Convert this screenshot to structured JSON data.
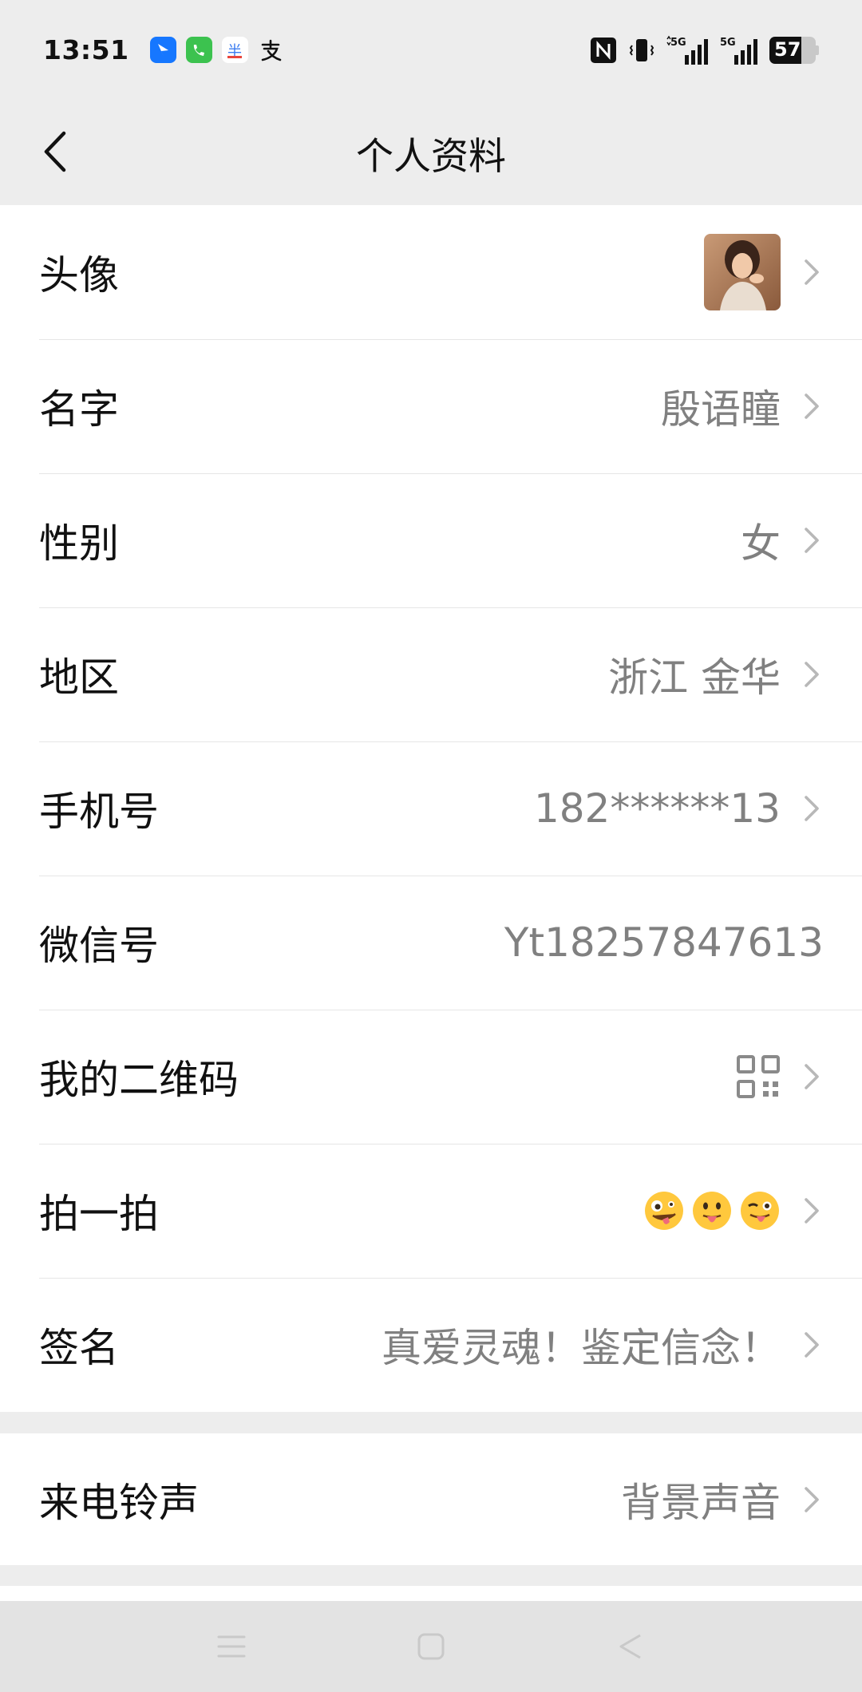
{
  "status_bar": {
    "time": "13:51",
    "battery": "57",
    "network": [
      "5G",
      "5G"
    ],
    "apps": [
      "dingtalk-icon",
      "phone-icon",
      "meituan-icon",
      "alipay-icon"
    ],
    "indicators": [
      "nfc-icon",
      "vibrate-icon",
      "signal-icon",
      "signal-icon",
      "battery-icon"
    ]
  },
  "navbar": {
    "title": "个人资料",
    "back_icon": "chevron-left-icon"
  },
  "profile": {
    "avatar_label": "头像",
    "name_label": "名字",
    "name_value": "殷语瞳",
    "gender_label": "性别",
    "gender_value": "女",
    "region_label": "地区",
    "region_value": "浙江 金华",
    "phone_label": "手机号",
    "phone_value": "182******13",
    "wechat_id_label": "微信号",
    "wechat_id_value": "Yt18257847613",
    "qrcode_label": "我的二维码",
    "pat_label": "拍一拍",
    "pat_emojis": [
      "zany-face",
      "tongue-face",
      "winking-tongue-face"
    ],
    "signature_label": "签名",
    "signature_value": "真爱灵魂！鉴定信念！"
  },
  "ringtone": {
    "label": "来电铃声",
    "value": "背景声音"
  },
  "system_nav": [
    "menu-icon",
    "home-icon",
    "back-icon"
  ],
  "colors": {
    "background": "#ededed",
    "card": "#ffffff",
    "value_text": "#808080",
    "chevron": "#b8b8b8"
  }
}
